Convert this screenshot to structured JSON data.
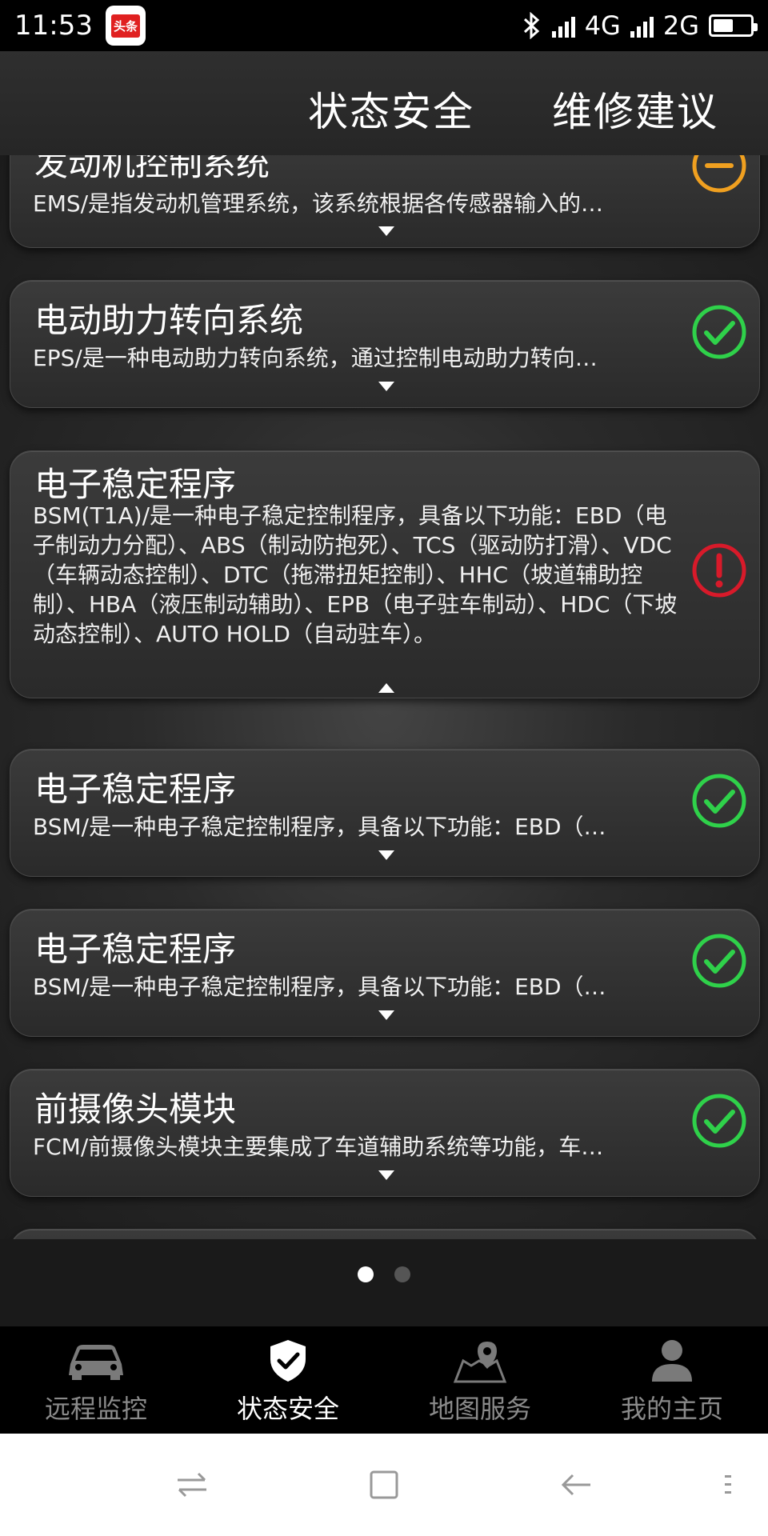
{
  "status_bar": {
    "time": "11:53",
    "app_badge": "头条",
    "network1": "4G",
    "network2": "2G",
    "battery_level": 0.55
  },
  "header": {
    "tab_status": "状态安全",
    "tab_repair": "维修建议"
  },
  "cards": [
    {
      "title": "发动机控制系统",
      "desc": "EMS/是指发动机管理系统，该系统根据各传感器输入的…",
      "status": "warning",
      "icon": "minus-circle-icon"
    },
    {
      "title": "电动助力转向系统",
      "desc": "EPS/是一种电动助力转向系统，通过控制电动助力转向…",
      "status": "ok",
      "icon": "check-circle-icon"
    },
    {
      "title": "电子稳定程序",
      "desc": "BSM(T1A)/是一种电子稳定控制程序，具备以下功能：EBD（电子制动力分配）、ABS（制动防抱死）、TCS（驱动防打滑）、VDC（车辆动态控制）、DTC（拖滞扭矩控制）、HHC（坡道辅助控制）、HBA（液压制动辅助）、EPB（电子驻车制动）、HDC（下坡动态控制）、AUTO HOLD（自动驻车）。",
      "status": "error",
      "icon": "exclamation-circle-icon"
    },
    {
      "title": "电子稳定程序",
      "desc": "BSM/是一种电子稳定控制程序，具备以下功能：EBD（…",
      "status": "ok",
      "icon": "check-circle-icon"
    },
    {
      "title": "电子稳定程序",
      "desc": "BSM/是一种电子稳定控制程序，具备以下功能：EBD（…",
      "status": "ok",
      "icon": "check-circle-icon"
    },
    {
      "title": "前摄像头模块",
      "desc": "FCM/前摄像头模块主要集成了车道辅助系统等功能，车…",
      "status": "ok",
      "icon": "check-circle-icon"
    }
  ],
  "colors": {
    "ok": "#2fd14a",
    "warning": "#f0a020",
    "error": "#d81a2a"
  },
  "pagination": {
    "current": 1,
    "total": 2
  },
  "bottom_nav": [
    {
      "label": "远程监控",
      "icon": "car-icon",
      "active": false
    },
    {
      "label": "状态安全",
      "icon": "shield-check-icon",
      "active": true
    },
    {
      "label": "地图服务",
      "icon": "map-pin-icon",
      "active": false
    },
    {
      "label": "我的主页",
      "icon": "user-icon",
      "active": false
    }
  ]
}
